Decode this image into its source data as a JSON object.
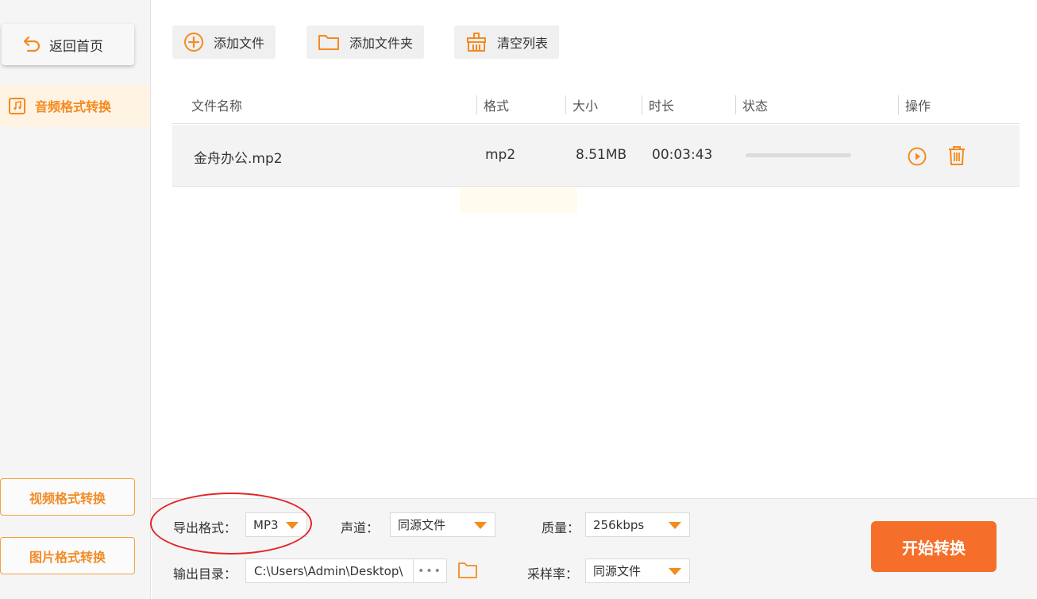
{
  "sidebar": {
    "back_label": "返回首页",
    "active_item": "音频格式转换",
    "video_label": "视频格式转换",
    "image_label": "图片格式转换"
  },
  "toolbar": {
    "add_file": "添加文件",
    "add_folder": "添加文件夹",
    "clear_list": "清空列表"
  },
  "table": {
    "headers": [
      "文件名称",
      "格式",
      "大小",
      "时长",
      "状态",
      "操作"
    ],
    "rows": [
      {
        "name": "金舟办公.mp2",
        "format": "mp2",
        "size": "8.51MB",
        "duration": "00:03:43",
        "progress": 0
      }
    ]
  },
  "settings": {
    "export_format_label": "导出格式：",
    "export_format_value": "MP3",
    "channel_label": "声道：",
    "channel_value": "同源文件",
    "quality_label": "质量：",
    "quality_value": "256kbps",
    "output_dir_label": "输出目录：",
    "output_dir_value": "C:\\Users\\Admin\\Desktop\\",
    "sample_rate_label": "采样率：",
    "sample_rate_value": "同源文件",
    "browse_dots": "•••",
    "start_label": "开始转换"
  },
  "colors": {
    "accent": "#f58a1f",
    "start_button": "#f56f2a",
    "annotation": "#e02828"
  }
}
